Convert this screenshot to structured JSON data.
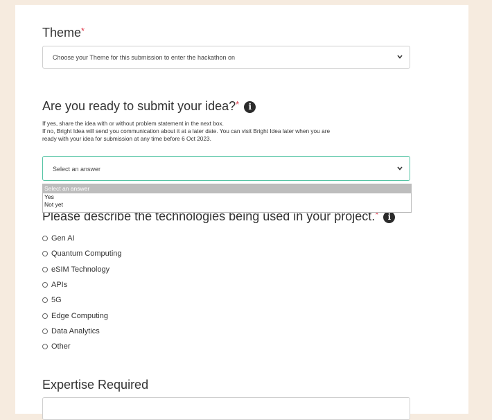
{
  "theme": {
    "title": "Theme",
    "required_mark": "*",
    "select_value": "Choose your Theme for this submission to enter the hackathon on"
  },
  "ready": {
    "title": "Are you ready to submit your idea?",
    "required_mark": "*",
    "info_icon": "info-icon",
    "help_lines": [
      "If yes, share the idea with or without problem statement in the next box.",
      "If no, Bright Idea will send you communication about it at a later date. You can visit Bright Idea later when you are",
      "ready with your idea for submission at any time before 6 Oct 2023."
    ],
    "select_value": "Select an answer",
    "options": [
      "Select an answer",
      "Yes",
      "Not yet"
    ]
  },
  "technologies": {
    "title": "Please describe the technologies being used in your project.",
    "required_mark": "*",
    "options": [
      "Gen AI",
      "Quantum Computing",
      "eSIM Technology",
      "APIs",
      "5G",
      "Edge Computing",
      "Data Analytics",
      "Other"
    ]
  },
  "expertise": {
    "title": "Expertise Required"
  },
  "colors": {
    "background": "#f6ebdf",
    "required": "#e0384a",
    "active_border": "#53c3a3"
  }
}
